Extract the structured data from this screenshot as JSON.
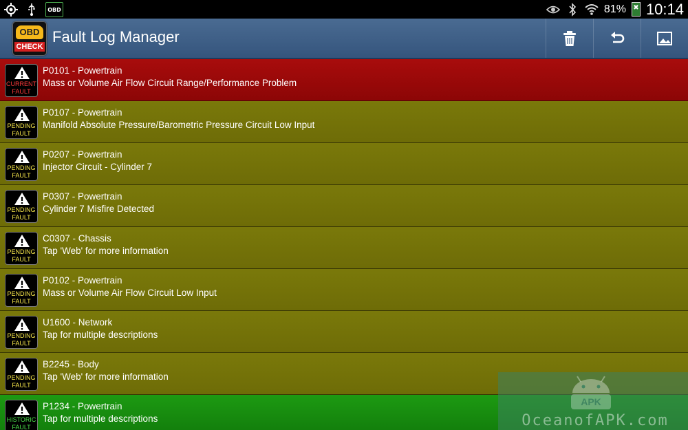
{
  "status_bar": {
    "left_icons": [
      "gps-icon",
      "usb-icon",
      "obd-notification-icon"
    ],
    "obd_mini_label": "OBD",
    "right_icons": [
      "eye-icon",
      "bluetooth-icon",
      "wifi-icon"
    ],
    "battery_percent": "81%",
    "time": "10:14"
  },
  "action_bar": {
    "title": "Fault Log Manager",
    "app_icon": {
      "top": "OBD",
      "bottom": "CHECK"
    },
    "actions": [
      "trash-icon",
      "undo-icon",
      "image-icon"
    ]
  },
  "faults": [
    {
      "status": "current",
      "badge1": "CURRENT",
      "badge2": "FAULT",
      "code": "P0101 - Powertrain",
      "desc": "Mass or Volume Air Flow Circuit Range/Performance Problem"
    },
    {
      "status": "pending",
      "badge1": "PENDING",
      "badge2": "FAULT",
      "code": "P0107 - Powertrain",
      "desc": "Manifold Absolute Pressure/Barometric Pressure Circuit Low Input"
    },
    {
      "status": "pending",
      "badge1": "PENDING",
      "badge2": "FAULT",
      "code": "P0207 - Powertrain",
      "desc": "Injector Circuit - Cylinder 7"
    },
    {
      "status": "pending",
      "badge1": "PENDING",
      "badge2": "FAULT",
      "code": "P0307 - Powertrain",
      "desc": "Cylinder 7 Misfire Detected"
    },
    {
      "status": "pending",
      "badge1": "PENDING",
      "badge2": "FAULT",
      "code": "C0307 - Chassis",
      "desc": "Tap 'Web' for more information"
    },
    {
      "status": "pending",
      "badge1": "PENDING",
      "badge2": "FAULT",
      "code": "P0102 - Powertrain",
      "desc": "Mass or Volume Air Flow Circuit Low Input"
    },
    {
      "status": "pending",
      "badge1": "PENDING",
      "badge2": "FAULT",
      "code": "U1600 - Network",
      "desc": "Tap for multiple descriptions"
    },
    {
      "status": "pending",
      "badge1": "PENDING",
      "badge2": "FAULT",
      "code": "B2245 - Body",
      "desc": "Tap 'Web' for more information"
    },
    {
      "status": "historic",
      "badge1": "HISTORIC",
      "badge2": "FAULT",
      "code": "P1234 - Powertrain",
      "desc": "Tap for multiple descriptions"
    }
  ],
  "watermark": {
    "text": "OceanofAPK.com",
    "badge": "APK"
  },
  "colors": {
    "current": "#a80c0c",
    "pending": "#757309",
    "historic": "#169010",
    "action_bar": "#3f6088"
  }
}
